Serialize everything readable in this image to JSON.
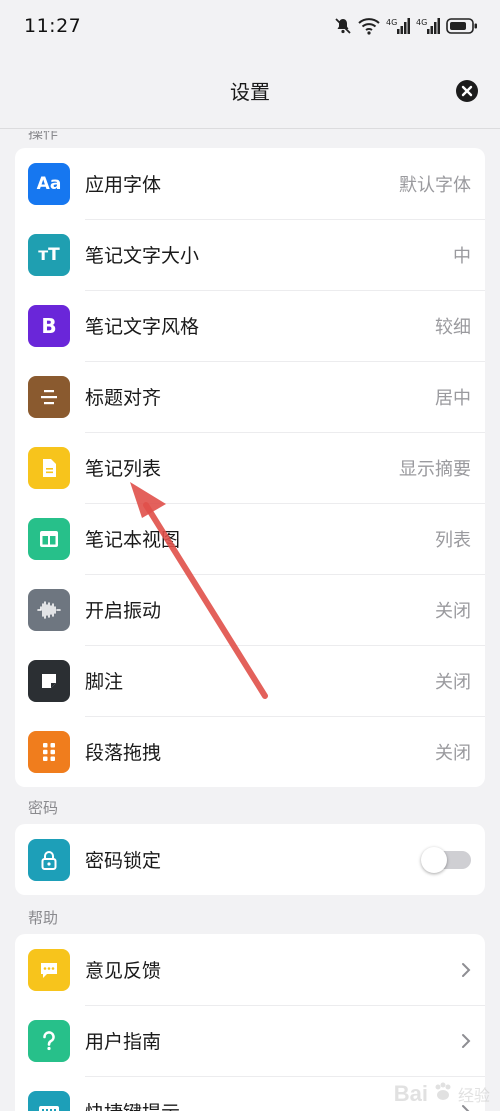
{
  "status_bar": {
    "time": "11:27",
    "icons": [
      "mute-icon",
      "wifi-icon",
      "signal-4g-icon",
      "signal-4g-icon",
      "battery-icon"
    ]
  },
  "header": {
    "title": "设置",
    "close_icon": "close-icon"
  },
  "sections": {
    "operation_label": "操作",
    "password_label": "密码",
    "help_label": "帮助"
  },
  "operation_items": [
    {
      "label": "应用字体",
      "value": "默认字体",
      "icon": "font-icon",
      "glyph": "Aa",
      "color": "#1677f0"
    },
    {
      "label": "笔记文字大小",
      "value": "中",
      "icon": "text-size-icon",
      "glyph": "тT",
      "color": "#1f9fb1"
    },
    {
      "label": "笔记文字风格",
      "value": "较细",
      "icon": "bold-icon",
      "glyph": "B",
      "color": "#6a26d9"
    },
    {
      "label": "标题对齐",
      "value": "居中",
      "icon": "align-center-icon",
      "glyph": "",
      "color": "#8a5a2f"
    },
    {
      "label": "笔记列表",
      "value": "显示摘要",
      "icon": "document-icon",
      "glyph": "",
      "color": "#f7c41c"
    },
    {
      "label": "笔记本视图",
      "value": "列表",
      "icon": "columns-icon",
      "glyph": "",
      "color": "#27c08a"
    },
    {
      "label": "开启振动",
      "value": "关闭",
      "icon": "vibration-wave-icon",
      "glyph": "",
      "color": "#6e7680"
    },
    {
      "label": "脚注",
      "value": "关闭",
      "icon": "sticky-note-icon",
      "glyph": "",
      "color": "#2b2f33"
    },
    {
      "label": "段落拖拽",
      "value": "关闭",
      "icon": "drag-grid-icon",
      "glyph": "",
      "color": "#f07d1d"
    }
  ],
  "password_items": [
    {
      "label": "密码锁定",
      "icon": "lock-icon",
      "color": "#1d9fb8",
      "toggle_on": false
    }
  ],
  "help_items": [
    {
      "label": "意见反馈",
      "icon": "feedback-icon",
      "color": "#f7c41c"
    },
    {
      "label": "用户指南",
      "icon": "question-icon",
      "color": "#27c08a"
    },
    {
      "label": "快捷键提示",
      "icon": "keyboard-icon",
      "color": "#1d9fb8"
    }
  ],
  "annotation": {
    "type": "arrow",
    "color": "#e0504a"
  },
  "watermark": {
    "text": "Bai",
    "sub": "经验"
  }
}
